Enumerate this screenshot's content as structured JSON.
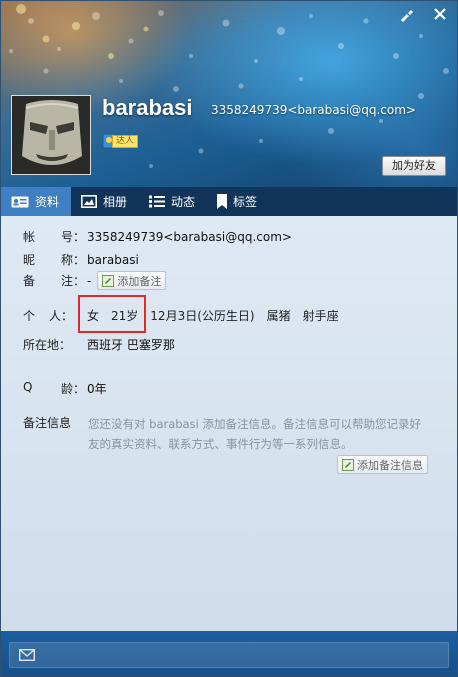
{
  "header": {
    "nickname": "barabasi",
    "account_line": "3358249739<barabasi@qq.com>",
    "badge_label": "达人",
    "add_friend_label": "加为好友",
    "tools": [
      "skin-icon",
      "close-icon"
    ]
  },
  "tabs": [
    {
      "label": "资料",
      "icon": "profile-card-icon",
      "active": true
    },
    {
      "label": "相册",
      "icon": "photo-album-icon",
      "active": false
    },
    {
      "label": "动态",
      "icon": "feed-list-icon",
      "active": false
    },
    {
      "label": "标签",
      "icon": "bookmark-icon",
      "active": false
    }
  ],
  "profile": {
    "account": {
      "label_a": "帐",
      "label_b": "号：",
      "value": "3358249739<barabasi@qq.com>"
    },
    "nickname": {
      "label_a": "昵",
      "label_b": "称：",
      "value": "barabasi"
    },
    "remark": {
      "label_a": "备",
      "label_b": "注：",
      "value": "-",
      "button": "添加备注"
    },
    "personal": {
      "label_a": "个",
      "label_b": "人：",
      "gender": "女",
      "age": "21岁",
      "birthday": "12月3日(公历生日)",
      "zodiac": "属猪",
      "constellation": "射手座"
    },
    "location": {
      "label": "所在地：",
      "value": "西班牙 巴塞罗那"
    },
    "q_age": {
      "label_a": "Q",
      "label_b": "龄：",
      "value": "0年"
    },
    "note_info": {
      "label": "备注信息",
      "desc_line1": "您还没有对 barabasi 添加备注信息。备注信息可以帮助您记录好",
      "desc_line2": "友的真实资料、联系方式、事件行为等一系列信息。",
      "button": "添加备注信息"
    }
  },
  "colors": {
    "tab_active": "#3f7fc3",
    "tabbar_bg": "#12335a",
    "highlight_box": "#e02b2b"
  },
  "bottom": {
    "icon": "mail-icon"
  }
}
